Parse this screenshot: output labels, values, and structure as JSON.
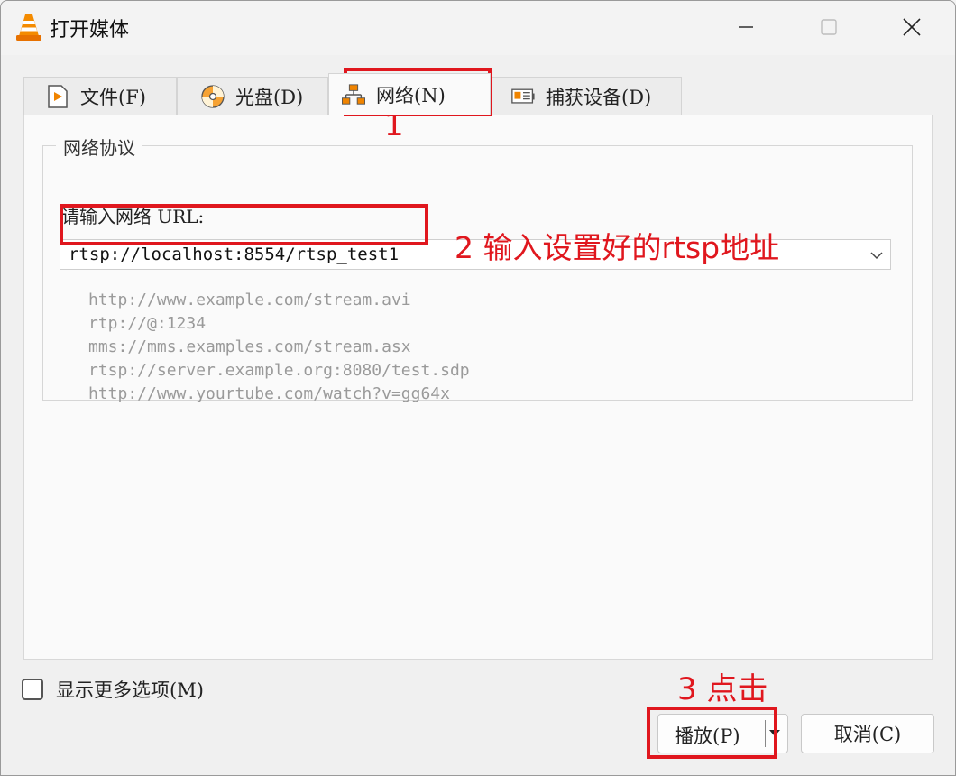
{
  "window": {
    "title": "打开媒体",
    "controls": [
      "minimize-icon",
      "maximize-icon",
      "close-icon"
    ]
  },
  "tabs": [
    {
      "label": "文件(F)",
      "icon": "file-play-icon",
      "active": false
    },
    {
      "label": "光盘(D)",
      "icon": "disc-icon",
      "active": false
    },
    {
      "label": "网络(N)",
      "icon": "network-icon",
      "active": true
    },
    {
      "label": "捕获设备(D)",
      "icon": "capture-card-icon",
      "active": false
    }
  ],
  "network": {
    "group_title": "网络协议",
    "url_label": "请输入网络 URL:",
    "url_value": "rtsp://localhost:8554/rtsp_test1",
    "examples": [
      "http://www.example.com/stream.avi",
      "rtp://@:1234",
      "mms://mms.examples.com/stream.asx",
      "rtsp://server.example.org:8080/test.sdp",
      "http://www.yourtube.com/watch?v=gg64x"
    ]
  },
  "footer": {
    "show_more_label": "显示更多选项(M)",
    "show_more_checked": false,
    "play_label": "播放(P)",
    "cancel_label": "取消(C)"
  },
  "annotations": {
    "step1": "1",
    "step2": "2 输入设置好的rtsp地址",
    "step3": "3 点击",
    "color": "#e0171e"
  }
}
